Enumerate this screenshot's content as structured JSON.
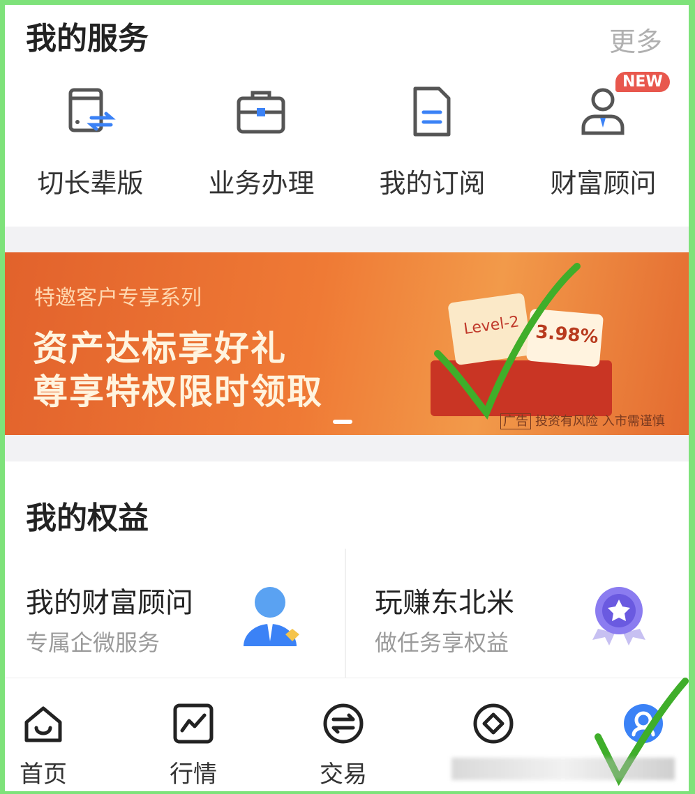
{
  "services": {
    "title": "我的服务",
    "more": "更多",
    "items": [
      {
        "label": "切长辈版",
        "icon": "tablet-switch-icon"
      },
      {
        "label": "业务办理",
        "icon": "briefcase-icon"
      },
      {
        "label": "我的订阅",
        "icon": "document-icon"
      },
      {
        "label": "财富顾问",
        "icon": "advisor-icon",
        "badge": "NEW"
      }
    ]
  },
  "banner": {
    "subtitle": "特邀客户专享系列",
    "line1": "资产达标享好礼",
    "line2": "尊享特权限时领取",
    "product": "Level-2",
    "rate": "3.98%",
    "ad_tag": "广告",
    "ad_note": "投资有风险 入市需谨慎"
  },
  "rights": {
    "title": "我的权益",
    "cards": [
      {
        "title": "我的财富顾问",
        "subtitle": "专属企微服务",
        "icon": "advisor-avatar-icon"
      },
      {
        "title": "玩赚东北米",
        "subtitle": "做任务享权益",
        "icon": "medal-icon"
      }
    ]
  },
  "tabbar": {
    "items": [
      {
        "label": "首页",
        "icon": "home-icon"
      },
      {
        "label": "行情",
        "icon": "chart-icon"
      },
      {
        "label": "交易",
        "icon": "exchange-icon"
      },
      {
        "label": "",
        "icon": "diamond-circle-icon"
      },
      {
        "label": "",
        "icon": "profile-icon",
        "active": true
      }
    ]
  },
  "colors": {
    "accent": "#e8574d",
    "brand_blue": "#3b82f6",
    "frame_green": "#7ee27a",
    "check_green": "#3fae2a"
  }
}
